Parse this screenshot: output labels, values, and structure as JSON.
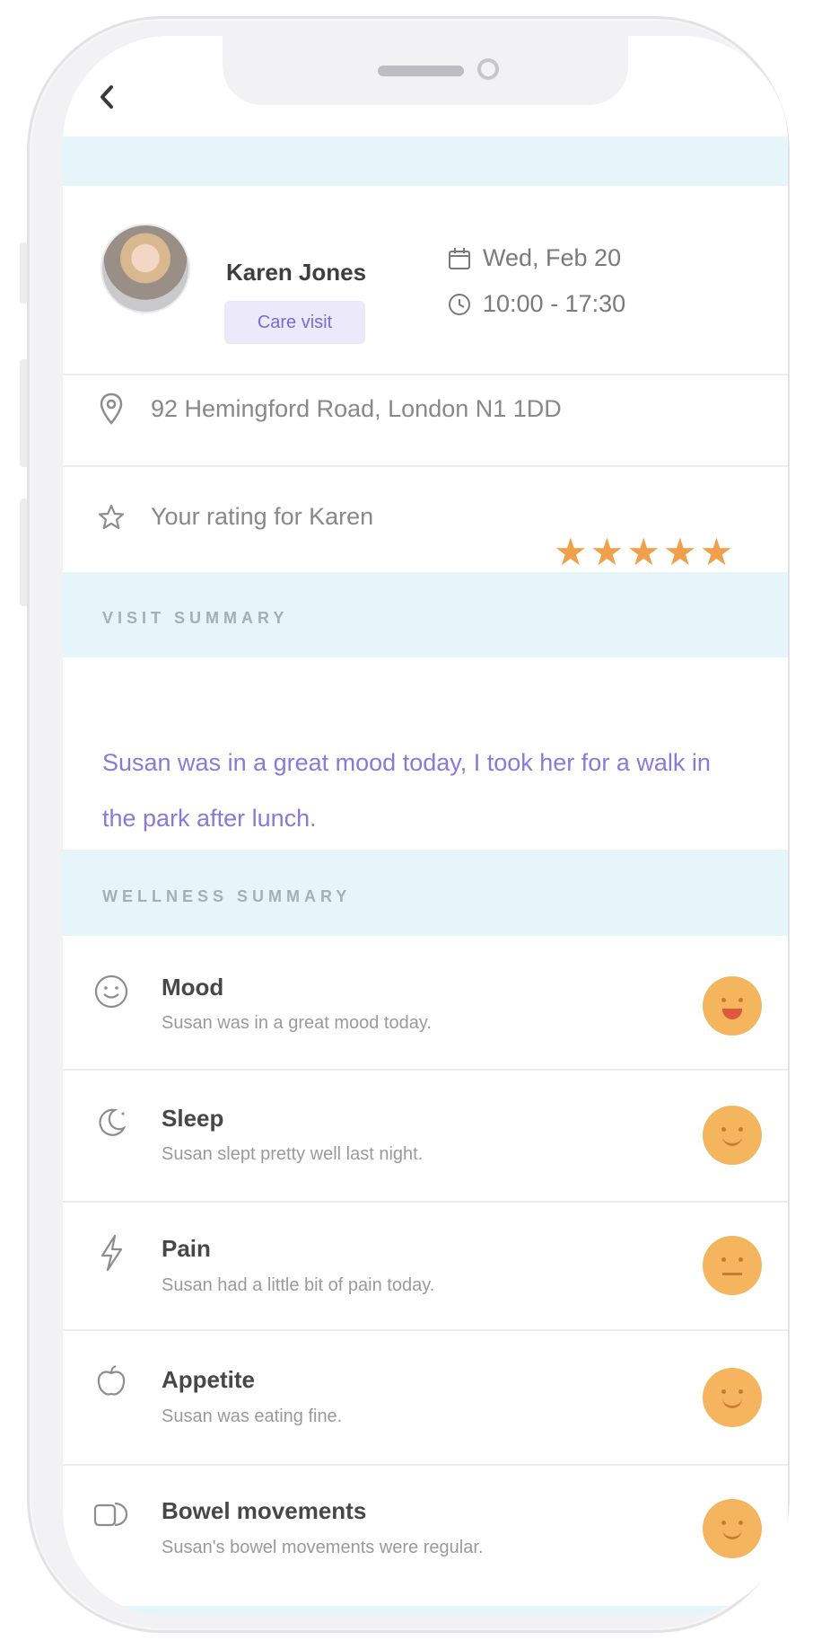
{
  "header": {
    "back_icon": "chevron-left-icon"
  },
  "visit": {
    "carer_name": "Karen Jones",
    "visit_type": "Care visit",
    "date": "Wed, Feb 20",
    "time": "10:00 - 17:30",
    "address": "92 Hemingford Road, London N1 1DD",
    "rating_label": "Your rating for Karen",
    "rating": {
      "value": 5,
      "max": 5
    }
  },
  "visit_summary": {
    "heading": "VISIT SUMMARY",
    "text": "Susan was in a great mood today, I took her for a walk in the park after lunch."
  },
  "wellness_summary": {
    "heading": "WELLNESS SUMMARY",
    "items": [
      {
        "title": "Mood",
        "description": "Susan was in a great mood today.",
        "icon": "smile-icon",
        "status": "happy-face"
      },
      {
        "title": "Sleep",
        "description": "Susan slept pretty well last night.",
        "icon": "moon-icon",
        "status": "smiling-face"
      },
      {
        "title": "Pain",
        "description": "Susan had a little bit of pain today.",
        "icon": "lightning-icon",
        "status": "neutral-face"
      },
      {
        "title": "Appetite",
        "description": "Susan was eating fine.",
        "icon": "apple-icon",
        "status": "smiling-face"
      },
      {
        "title": "Bowel movements",
        "description": "Susan's bowel movements were regular.",
        "icon": "toilet-icon",
        "status": "smiling-face"
      }
    ]
  },
  "colors": {
    "accent": "#8a79d8",
    "band": "#e6f5fa",
    "star": "#f0a04a",
    "face": "#f4b55e"
  }
}
